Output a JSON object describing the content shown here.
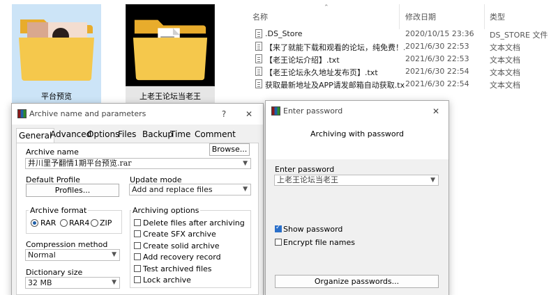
{
  "explorer": {
    "folders": [
      {
        "label": "平台预览"
      },
      {
        "label": "上老王论坛当老王"
      }
    ],
    "columns": {
      "name": "名称",
      "date": "修改日期",
      "type": "类型"
    },
    "files": [
      {
        "name": ".DS_Store",
        "date": "2020/10/15 23:36",
        "type": "DS_STORE 文件"
      },
      {
        "name": "【来了就能下载和观看的论坛，纯免费！...",
        "date": "2021/6/30 22:53",
        "type": "文本文档"
      },
      {
        "name": "【老王论坛介绍】.txt",
        "date": "2021/6/30 22:53",
        "type": "文本文档"
      },
      {
        "name": "【老王论坛永久地址发布页】.txt",
        "date": "2021/6/30 22:54",
        "type": "文本文档"
      },
      {
        "name": "获取最新地址及APP请发邮箱自动获取.txt",
        "date": "2021/6/30 22:54",
        "type": "文本文档"
      }
    ]
  },
  "archive_dialog": {
    "title": "Archive name and parameters",
    "help": "?",
    "close": "✕",
    "tabs": [
      "General",
      "Advanced",
      "Options",
      "Files",
      "Backup",
      "Time",
      "Comment"
    ],
    "archive_name_label": "Archive name",
    "browse_label": "Browse...",
    "archive_name_value": "井川里予翻情1期平台预览.rar",
    "default_profile_label": "Default Profile",
    "profiles_label": "Profiles...",
    "update_mode_label": "Update mode",
    "update_mode_value": "Add and replace files",
    "archive_format_label": "Archive format",
    "formats": [
      "RAR",
      "RAR4",
      "ZIP"
    ],
    "selected_format": "RAR",
    "compression_label": "Compression method",
    "compression_value": "Normal",
    "dictionary_label": "Dictionary size",
    "dictionary_value": "32 MB",
    "archiving_options_label": "Archiving options",
    "options": [
      {
        "label": "Delete files after archiving",
        "checked": false
      },
      {
        "label": "Create SFX archive",
        "checked": false
      },
      {
        "label": "Create solid archive",
        "checked": false
      },
      {
        "label": "Add recovery record",
        "checked": false
      },
      {
        "label": "Test archived files",
        "checked": false
      },
      {
        "label": "Lock archive",
        "checked": false
      }
    ]
  },
  "password_dialog": {
    "title": "Enter password",
    "close": "✕",
    "heading": "Archiving with password",
    "enter_label": "Enter password",
    "password_value": "上老王论坛当老王",
    "show_password_label": "Show password",
    "show_password_checked": true,
    "encrypt_names_label": "Encrypt file names",
    "encrypt_names_checked": false,
    "organize_label": "Organize passwords..."
  },
  "colors": {
    "folder": "#f5c84c",
    "selection": "#cce4f7",
    "checkbox_accent": "#2a6fc9"
  }
}
